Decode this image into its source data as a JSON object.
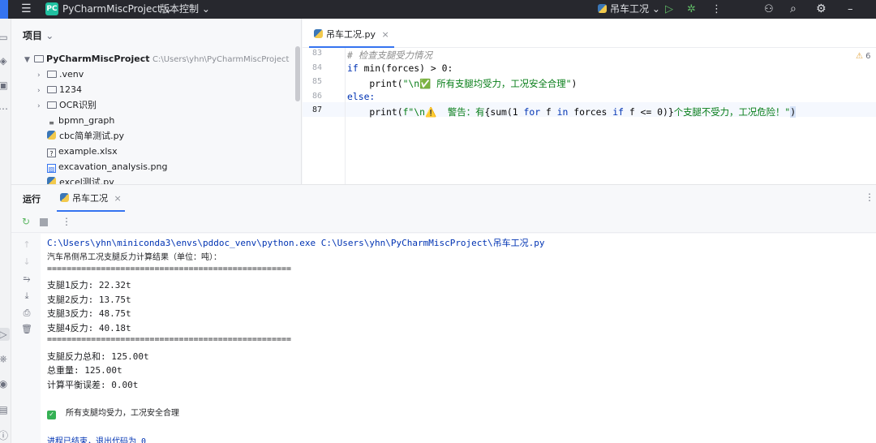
{
  "titlebar": {
    "logo": "PC",
    "project_name": "PyCharmMiscProject",
    "vcs": "版本控制",
    "run_config": "吊车工况"
  },
  "project_panel": {
    "title": "项目",
    "root": "PyCharmMiscProject",
    "root_path": "C:\\Users\\yhn\\PyCharmMiscProject",
    "items": [
      {
        "label": ".venv"
      },
      {
        "label": "1234"
      },
      {
        "label": "OCR识别"
      },
      {
        "label": "bpmn_graph"
      },
      {
        "label": "cbc简单测试.py"
      },
      {
        "label": "example.xlsx"
      },
      {
        "label": "excavation_analysis.png"
      },
      {
        "label": "excel测试.py"
      }
    ]
  },
  "editor": {
    "tab": "吊车工况.py",
    "warnings_count": "6",
    "line_numbers": [
      "83",
      "84",
      "85",
      "86",
      "87"
    ],
    "lines": {
      "l83": "# 检查支腿受力情况",
      "l84_kw1": "if ",
      "l84_a": "min(forces) > 0:",
      "l85_a": "    print(",
      "l85_str": "\"\\n✅ 所有支腿均受力，工况安全合理\"",
      "l85_b": ")",
      "l86_kw": "else:",
      "l87_a": "    print(",
      "l87_str1": "f\"\\n⚠️  警告：有",
      "l87_expr_a": "{sum(1 ",
      "l87_for": "for",
      "l87_expr_b": " f ",
      "l87_in": "in",
      "l87_expr_c": " forces ",
      "l87_if": "if",
      "l87_expr_d": " f <= 0)}",
      "l87_str2": "个支腿不受力，工况危险！\"",
      "l87_b": ")"
    }
  },
  "run_panel": {
    "title": "运行",
    "tab": "吊车工况",
    "console": {
      "cmd": "C:\\Users\\yhn\\miniconda3\\envs\\pddoc_venv\\python.exe C:\\Users\\yhn\\PyCharmMiscProject\\吊车工况.py",
      "l1": "汽车吊侧吊工况支腿反力计算结果（单位：吨）：",
      "sep": "==================================================",
      "leg1": "支腿1反力: 22.32t",
      "leg2": "支腿2反力: 13.75t",
      "leg3": "支腿3反力: 48.75t",
      "leg4": "支腿4反力: 40.18t",
      "sep2": "==================================================",
      "sum": "支腿反力总和: 125.00t",
      "total": "总重量: 125.00t",
      "err": "计算平衡误差: 0.00t",
      "ok": "所有支腿均受力，工况安全合理",
      "exit": "进程已结束，退出代码为 0"
    }
  }
}
